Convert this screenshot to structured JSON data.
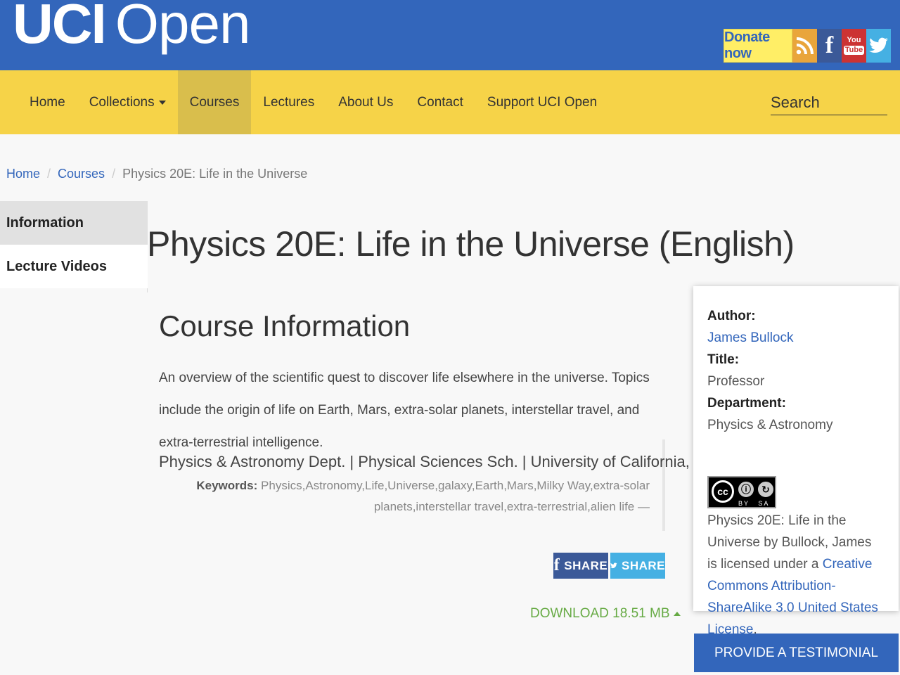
{
  "header": {
    "logo_bold": "UCI",
    "logo_light": "Open",
    "donate_label": "Donate now",
    "social_icons": [
      "rss-icon",
      "facebook-icon",
      "youtube-icon",
      "twitter-icon"
    ],
    "youtube_top": "You",
    "youtube_bottom": "Tube",
    "facebook_glyph": "f"
  },
  "nav": {
    "items": [
      {
        "label": "Home"
      },
      {
        "label": "Collections"
      },
      {
        "label": "Courses"
      },
      {
        "label": "Lectures"
      },
      {
        "label": "About Us"
      },
      {
        "label": "Contact"
      },
      {
        "label": "Support UCI Open"
      }
    ],
    "active": "Courses",
    "search_placeholder": "Search"
  },
  "breadcrumb": {
    "items": [
      "Home",
      "Courses"
    ],
    "current": "Physics 20E: Life in the Universe",
    "separator": "/"
  },
  "side_tabs": [
    "Information",
    "Lecture Videos"
  ],
  "main": {
    "title": "Physics 20E: Life in the Universe (English)",
    "section_title": "Course Information",
    "description": "An overview of the scientific quest to discover life elsewhere in the universe. Topics include the origin of life on Earth, Mars, extra-solar planets, interstellar travel, and extra-terrestrial intelligence.",
    "affiliation": "Physics & Astronomy Dept. | Physical Sciences Sch. | University of California, Irvine",
    "keywords_label": "Keywords:",
    "keywords": "Physics,Astronomy,Life,Universe,galaxy,Earth,Mars,Milky Way,extra-solar planets,interstellar travel,extra-terrestrial,alien life —",
    "share_facebook": "SHARE",
    "share_twitter": "SHARE",
    "download": "DOWNLOAD 18.51 MB"
  },
  "card": {
    "author_label": "Author:",
    "author": "James Bullock",
    "title_label": "Title:",
    "title": "Professor",
    "department_label": "Department:",
    "department": "Physics & Astronomy",
    "cc_badge": {
      "cc": "cc",
      "by": "BY",
      "sa": "SA",
      "by_glyph": "ⓘ",
      "sa_glyph": "↻"
    },
    "license_text": "Physics 20E: Life in the Universe by Bullock, James is licensed under a ",
    "license_link": "Creative Commons Attribution-ShareAlike 3.0 United States License",
    "license_end": "."
  },
  "testimonial_label": "PROVIDE A TESTIMONIAL",
  "colors": {
    "header_blue": "#3366bb",
    "nav_yellow": "#f6d348",
    "donate_yellow": "#ffee66",
    "download_green": "#66aa44"
  }
}
